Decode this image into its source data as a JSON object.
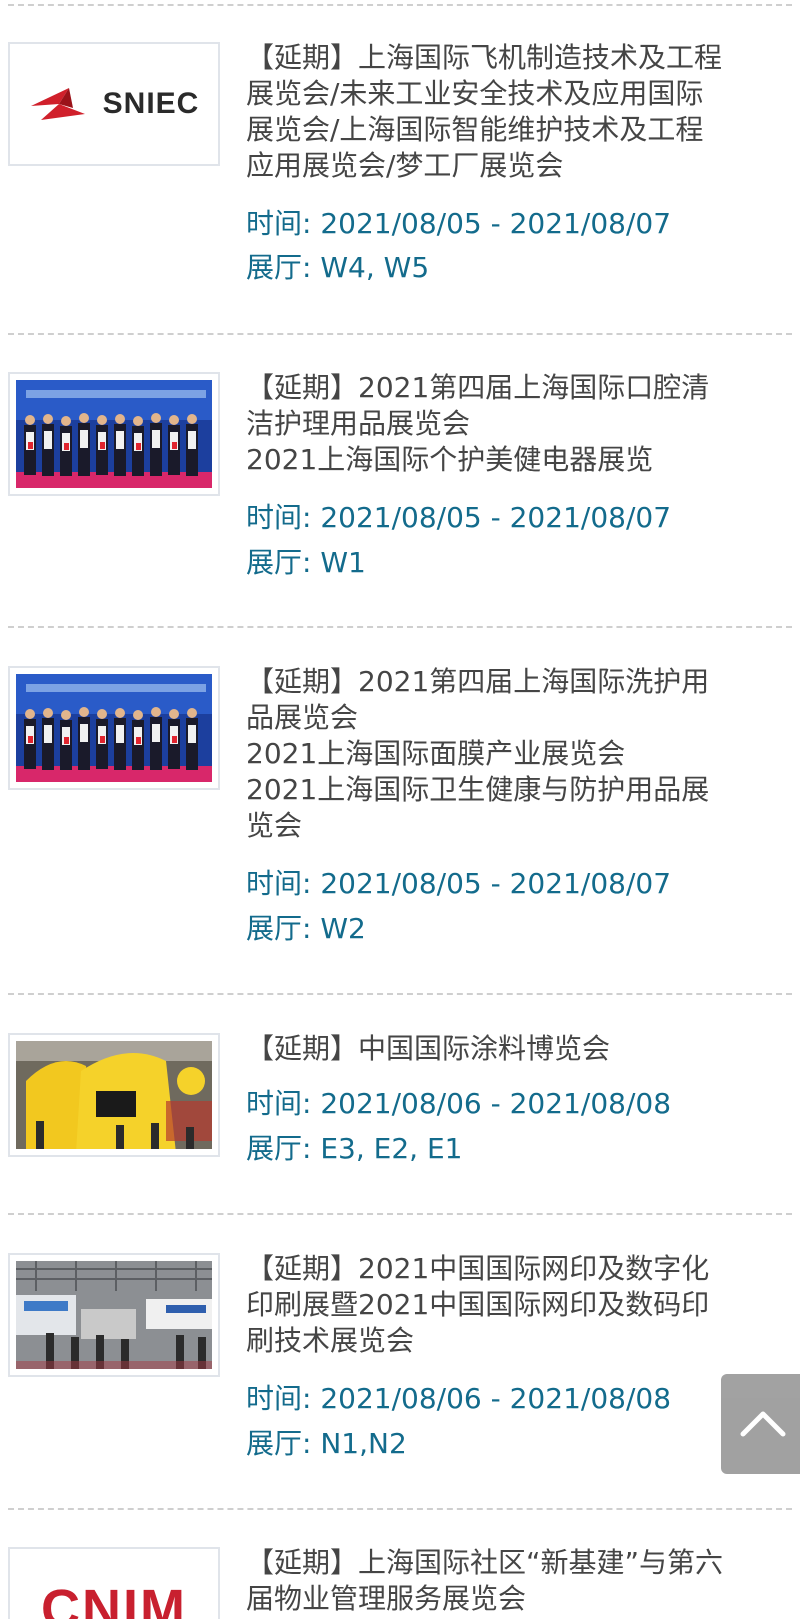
{
  "items": [
    {
      "title": "【延期】上海国际飞机制造技术及工程\n展览会/未来工业安全技术及应用国际\n展览会/上海国际智能维护技术及工程\n应用展览会/梦工厂展览会",
      "time": "时间: 2021/08/05 - 2021/08/07",
      "hall": "展厅: W4, W5",
      "image": "sniec-logo",
      "logo_text": "SNIEC"
    },
    {
      "title": "【延期】2021第四届上海国际口腔清\n洁护理用品展览会\n2021上海国际个护美健电器展览",
      "time": "时间: 2021/08/05 - 2021/08/07",
      "hall": "展厅: W1",
      "image": "award-ceremony-photo"
    },
    {
      "title": "【延期】2021第四届上海国际洗护用\n品展览会\n2021上海国际面膜产业展览会\n2021上海国际卫生健康与防护用品展\n览会",
      "time": "时间: 2021/08/05 - 2021/08/07",
      "hall": "展厅: W2",
      "image": "award-ceremony-photo"
    },
    {
      "title": "【延期】中国国际涂料博览会",
      "time": "时间: 2021/08/06 - 2021/08/08",
      "hall": "展厅: E3, E2, E1",
      "image": "coatings-booth-photo"
    },
    {
      "title": "【延期】2021中国国际网印及数字化\n印刷展暨2021中国国际网印及数码印\n刷技术展览会",
      "time": "时间: 2021/08/06 - 2021/08/08",
      "hall": "展厅: N1,N2",
      "image": "exhibition-hall-photo"
    },
    {
      "title": "【延期】上海国际社区“新基建”与第六\n届物业管理服务展览会",
      "image": "cnim-logo",
      "logo_text": "CNIM"
    }
  ],
  "back_to_top": {
    "icon": "chevron-up-icon"
  },
  "colors": {
    "title": "#454545",
    "meta": "#136b8c",
    "divider": "#cfcfcf",
    "back_to_top_bg": "#9a9a9a"
  }
}
